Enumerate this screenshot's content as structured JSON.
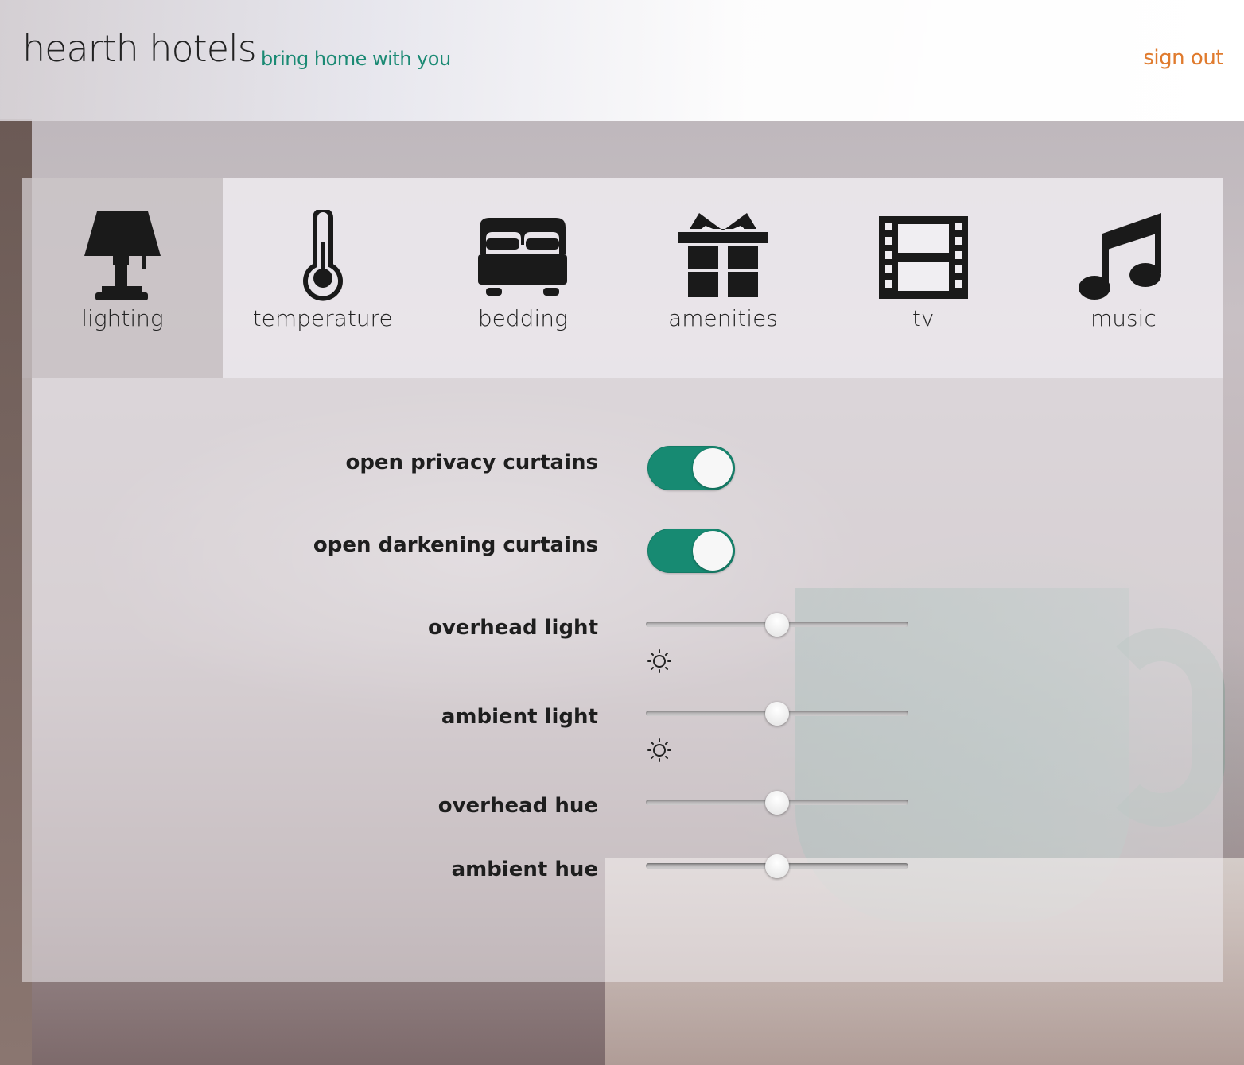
{
  "header": {
    "brand": "hearth hotels",
    "tagline": "bring home with you",
    "signout": "sign out"
  },
  "tabs": [
    {
      "label": "lighting",
      "icon": "lamp-icon",
      "active": true
    },
    {
      "label": "temperature",
      "icon": "thermometer-icon",
      "active": false
    },
    {
      "label": "bedding",
      "icon": "bed-icon",
      "active": false
    },
    {
      "label": "amenities",
      "icon": "gift-icon",
      "active": false
    },
    {
      "label": "tv",
      "icon": "film-icon",
      "active": false
    },
    {
      "label": "music",
      "icon": "music-note-icon",
      "active": false
    }
  ],
  "lighting": {
    "privacy_curtains": {
      "label": "open privacy curtains",
      "on": true
    },
    "darkening_curtains": {
      "label": "open darkening curtains",
      "on": true
    },
    "overhead_light": {
      "label": "overhead light",
      "value": 0.5,
      "icon": "sun-icon"
    },
    "ambient_light": {
      "label": "ambient light",
      "value": 0.5,
      "icon": "sun-icon"
    },
    "overhead_hue": {
      "label": "overhead hue",
      "value": 0.5
    },
    "ambient_hue": {
      "label": "ambient hue",
      "value": 0.5
    }
  },
  "colors": {
    "accent": "#178a72",
    "tagline": "#1b8a74",
    "signout": "#e07b2e"
  }
}
